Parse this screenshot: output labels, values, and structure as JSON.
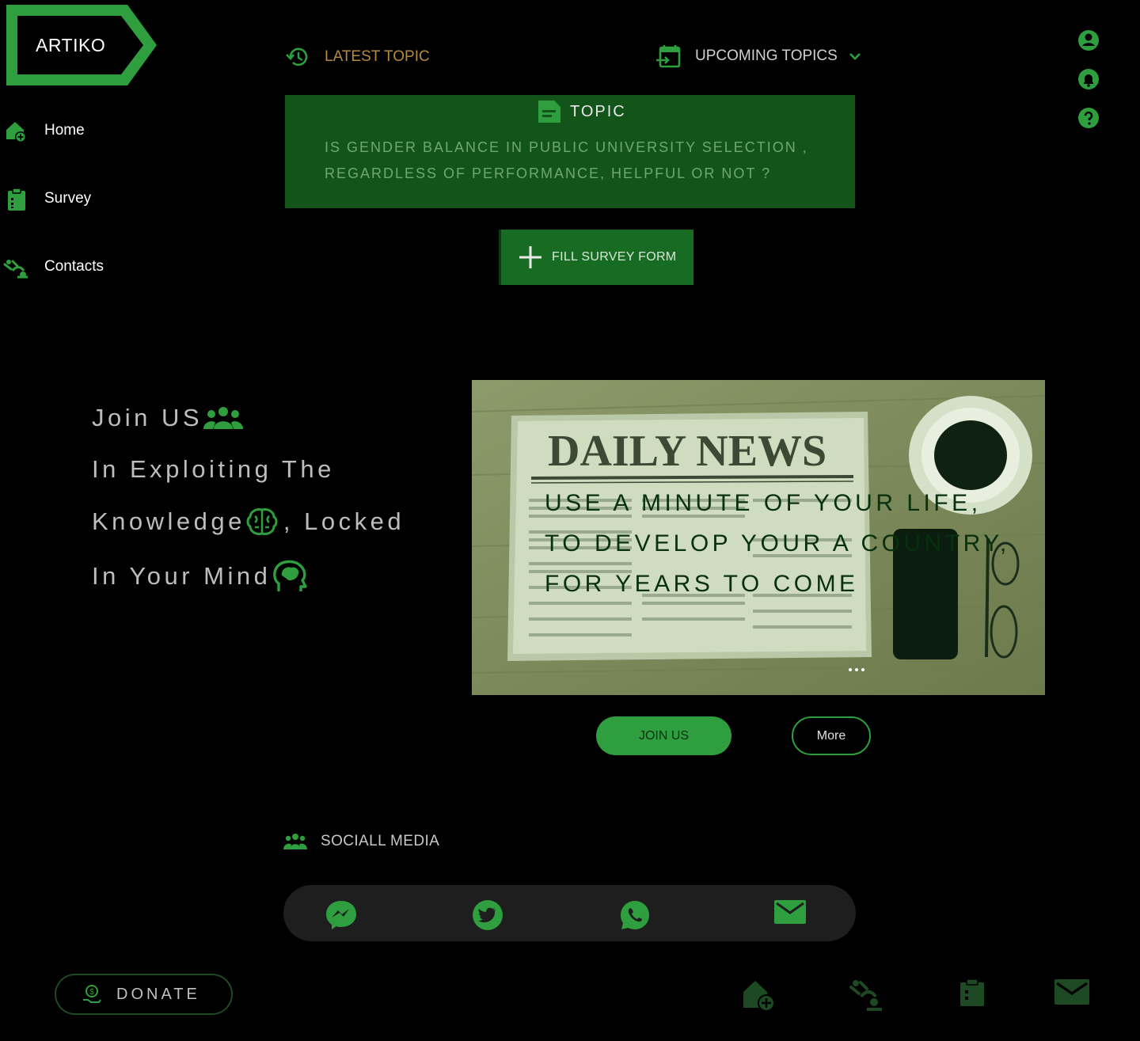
{
  "brand": {
    "name": "ARTIKO"
  },
  "sidebar": {
    "items": [
      {
        "label": "Home",
        "icon": "home-add-icon"
      },
      {
        "label": "Survey",
        "icon": "clipboard-icon"
      },
      {
        "label": "Contacts",
        "icon": "contacts-icon"
      }
    ]
  },
  "topnav": {
    "latest": "LATEST TOPIC",
    "upcoming": "UPCOMING TOPICS"
  },
  "topic": {
    "heading": "TOPIC",
    "line1": "IS GENDER BALANCE IN PUBLIC UNIVERSITY SELECTION ,",
    "line2": "REGARDLESS OF PERFORMANCE,  HELPFUL OR NOT ?"
  },
  "fill_survey": {
    "label": "FILL SURVEY FORM"
  },
  "join": {
    "line1": "Join US",
    "line2": "In Exploiting The",
    "line3": "Knowledge",
    "line3b": ", Locked",
    "line4": "In Your Mind"
  },
  "hero": {
    "newspaper_title": "DAILY NEWS",
    "line1": "USE A MINUTE OF YOUR LIFE,",
    "line2": "TO DEVELOP YOUR A COUNTRY,",
    "line3": "FOR YEARS TO COME"
  },
  "buttons": {
    "join": "JOIN US",
    "more": "More"
  },
  "social": {
    "heading": "SOCIALL MEDIA"
  },
  "donate": {
    "label": "DONATE"
  },
  "colors": {
    "accent": "#2e9e3e",
    "dark_green": "#13541b",
    "latest_text": "#b58a3c",
    "background": "#000000"
  }
}
